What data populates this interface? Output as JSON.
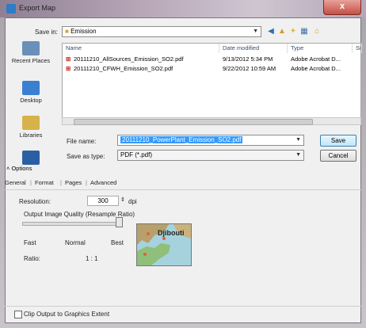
{
  "window": {
    "title": "Export Map",
    "close_glyph": "x"
  },
  "toolbar": {
    "save_in_label": "Save in:",
    "save_in_value": "Emission"
  },
  "places": [
    {
      "label": "Recent Places",
      "color": "#6a8fb8"
    },
    {
      "label": "Desktop",
      "color": "#3a7fd0"
    },
    {
      "label": "Libraries",
      "color": "#d7b24b"
    },
    {
      "label": "",
      "color": "#2b5fa4"
    }
  ],
  "file_list": {
    "columns": [
      "Name",
      "Date modified",
      "Type",
      "Si"
    ],
    "rows": [
      {
        "name": "20111210_AllSources_Emission_SO2.pdf",
        "date": "9/13/2012 5:34 PM",
        "type": "Adobe Acrobat D..."
      },
      {
        "name": "20111210_CFWH_Emission_SO2.pdf",
        "date": "9/22/2012 10:59 AM",
        "type": "Adobe Acrobat D..."
      }
    ]
  },
  "form": {
    "file_name_label": "File name:",
    "file_name_value": "20111210_PowerPlant_Emission_SO2.pdf",
    "save_as_type_label": "Save as type:",
    "save_as_type_value": "PDF (*.pdf)",
    "save_button": "Save",
    "cancel_button": "Cancel"
  },
  "options": {
    "label": "Options"
  },
  "tabs": [
    "General",
    "Format",
    "Pages",
    "Advanced"
  ],
  "general": {
    "resolution_label": "Resolution:",
    "resolution_value": "300",
    "resolution_unit": "dpi",
    "quality_label": "Output Image Quality (Resample Ratio)",
    "quality_fraction": 1,
    "fast_label": "Fast",
    "normal_label": "Normal",
    "best_label": "Best",
    "ratio_label": "Ratio:",
    "ratio_value": "1 : 1",
    "preview_label": "Djibouti"
  },
  "footer": {
    "clip_label": "Clip Output to Graphics Extent",
    "clip_checked": false
  },
  "colors": {
    "selection": "#3399ff",
    "default_button": "#bee6fd",
    "pdf_icon": "#c52a1f"
  }
}
